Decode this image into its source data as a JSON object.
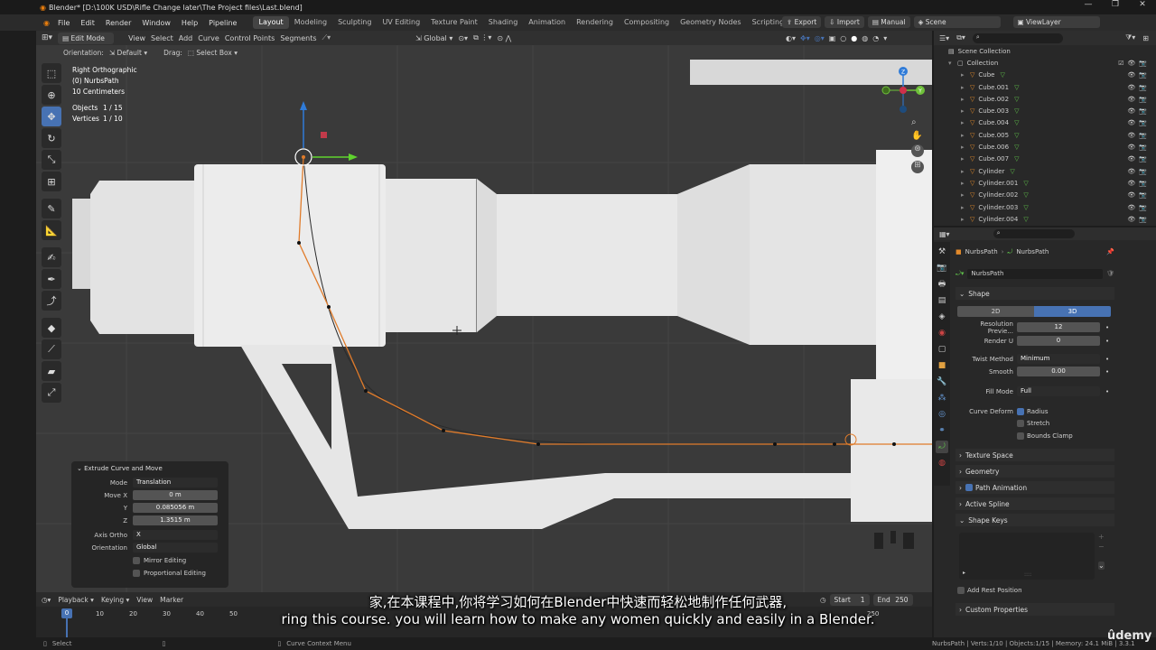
{
  "titlebar": {
    "text": "Blender* [D:\\100K USD\\Rifle Change later\\The Project files\\Last.blend]"
  },
  "menubar": {
    "menus": [
      "File",
      "Edit",
      "Render",
      "Window",
      "Help",
      "Pipeline"
    ],
    "workspaces": [
      "Layout",
      "Modeling",
      "Sculpting",
      "UV Editing",
      "Texture Paint",
      "Shading",
      "Animation",
      "Rendering",
      "Compositing",
      "Geometry Nodes",
      "Scripting"
    ],
    "active_workspace": "Layout",
    "add_tab": "+",
    "export": "Export",
    "import": "Import",
    "manual": "Manual",
    "scene": "Scene",
    "view_layer": "ViewLayer"
  },
  "viewport_header": {
    "mode": "Edit Mode",
    "menus": [
      "View",
      "Select",
      "Add",
      "Curve",
      "Control Points",
      "Segments"
    ],
    "transform": "Global"
  },
  "viewport_header2": {
    "orientation_label": "Orientation:",
    "orientation_value": "Default",
    "drag_label": "Drag:",
    "drag_value": "Select Box"
  },
  "viewport_info": {
    "view": "Right Orthographic",
    "object": "(0) NurbsPath",
    "scale": "10 Centimeters",
    "objects_label": "Objects",
    "objects_value": "1 / 15",
    "vertices_label": "Vertices",
    "vertices_value": "1 / 10"
  },
  "operator_panel": {
    "title": "Extrude Curve and Move",
    "mode_label": "Mode",
    "mode_value": "Translation",
    "move_x_label": "Move X",
    "move_x_value": "0 m",
    "y_label": "Y",
    "y_value": "0.085056 m",
    "z_label": "Z",
    "z_value": "1.3515 m",
    "axis_ortho_label": "Axis Ortho",
    "axis_ortho_value": "X",
    "orientation_label": "Orientation",
    "orientation_value": "Global",
    "mirror": "Mirror Editing",
    "proportional": "Proportional Editing"
  },
  "outliner": {
    "scene_collection": "Scene Collection",
    "collection": "Collection",
    "items": [
      "Cube",
      "Cube.001",
      "Cube.002",
      "Cube.003",
      "Cube.004",
      "Cube.005",
      "Cube.006",
      "Cube.007",
      "Cylinder",
      "Cylinder.001",
      "Cylinder.002",
      "Cylinder.003",
      "Cylinder.004"
    ]
  },
  "properties": {
    "breadcrumb_a": "NurbsPath",
    "breadcrumb_b": "NurbsPath",
    "datablock": "NurbsPath",
    "shape_section": "Shape",
    "dim_2d": "2D",
    "dim_3d": "3D",
    "res_preview_label": "Resolution Previe...",
    "res_preview_value": "12",
    "render_u_label": "Render U",
    "render_u_value": "0",
    "twist_label": "Twist Method",
    "twist_value": "Minimum",
    "smooth_label": "Smooth",
    "smooth_value": "0.00",
    "fill_label": "Fill Mode",
    "fill_value": "Full",
    "curve_deform_label": "Curve Deform",
    "radius": "Radius",
    "stretch": "Stretch",
    "bounds_clamp": "Bounds Clamp",
    "texture_space": "Texture Space",
    "geometry": "Geometry",
    "path_animation": "Path Animation",
    "active_spline": "Active Spline",
    "shape_keys": "Shape Keys",
    "add_rest_position": "Add Rest Position",
    "custom_properties": "Custom Properties"
  },
  "timeline": {
    "menus": [
      "Playback",
      "Keying",
      "View",
      "Marker"
    ],
    "start_label": "Start",
    "start_value": "1",
    "end_label": "End",
    "end_value": "250",
    "current_frame": "0",
    "ticks": [
      "0",
      "10",
      "20",
      "30",
      "40",
      "50"
    ],
    "end_tick": "250"
  },
  "statusbar": {
    "left": "Select",
    "middle": "Curve Context Menu",
    "right": "NurbsPath | Verts:1/10 | Objects:1/15 | Memory: 24.1 MiB | 3.3.1"
  },
  "subtitles": {
    "chinese": "家,在本课程中,你将学习如何在Blender中快速而轻松地制作任何武器,",
    "english": "ring this course. you will learn how to make any women quickly and easily in a Blender."
  },
  "watermark": "ûdemy",
  "colors": {
    "accent": "#4772b3",
    "curve": "#e07b2a",
    "object": "#e38a2b",
    "mesh": "#5fc14a"
  }
}
